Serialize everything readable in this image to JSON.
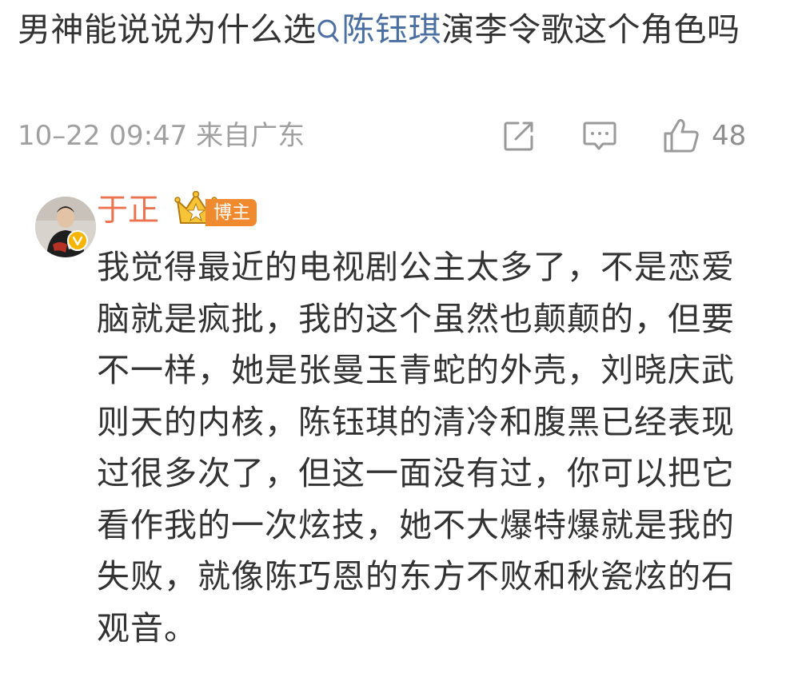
{
  "post": {
    "text_before": "男神能说说为什么选",
    "topic": "陈钰琪",
    "text_after": "演李令歌这个角色吗",
    "meta": "10–22 09:47 来自广东",
    "like_count": "48",
    "icons": {
      "topic": "search-icon",
      "share": "share-icon",
      "comment": "comment-icon",
      "like": "thumbs-up-icon"
    }
  },
  "reply": {
    "username": "于正",
    "badge": "博主",
    "text": "我觉得最近的电视剧公主太多了，不是恋爱脑就是疯批，我的这个虽然也颠颠的，但要不一样，她是张曼玉青蛇的外壳，刘晓庆武则天的内核，陈钰琪的清冷和腹黑已经表现过很多次了，但这一面没有过，你可以把它看作我的一次炫技，她不大爆特爆就是我的失败，就像陈巧恩的东方不败和秋瓷炫的石观音。",
    "icons": {
      "avatar": "avatar",
      "verified": "verified-badge-icon",
      "crown": "crown-icon"
    }
  },
  "colors": {
    "text": "#333333",
    "meta": "#a0a0a0",
    "link": "#4a6fa0",
    "username": "#eb7350",
    "badge": "#f08a2e",
    "verified": "#f7b500"
  }
}
